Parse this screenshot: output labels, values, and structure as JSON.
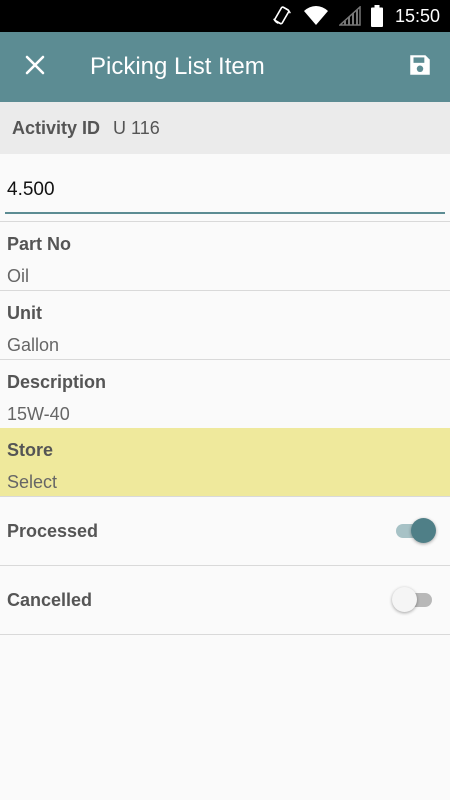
{
  "status_bar": {
    "time": "15:50",
    "icons": [
      "rotate-icon",
      "wifi-icon",
      "signal-icon",
      "battery-icon"
    ]
  },
  "app_bar": {
    "title": "Picking List Item",
    "close_icon": "close-icon",
    "save_icon": "save-icon",
    "color": "#5c8c93"
  },
  "activity": {
    "label": "Activity ID",
    "value": "U 116"
  },
  "quantity": {
    "value": "4.500"
  },
  "fields": [
    {
      "label": "Part No",
      "value": "Oil"
    },
    {
      "label": "Unit",
      "value": "Gallon"
    },
    {
      "label": "Description",
      "value": "15W-40"
    },
    {
      "label": "Store",
      "value": "Select",
      "highlight_color": "#efe99c"
    }
  ],
  "toggles": [
    {
      "label": "Processed",
      "state": "on"
    },
    {
      "label": "Cancelled",
      "state": "off"
    }
  ]
}
